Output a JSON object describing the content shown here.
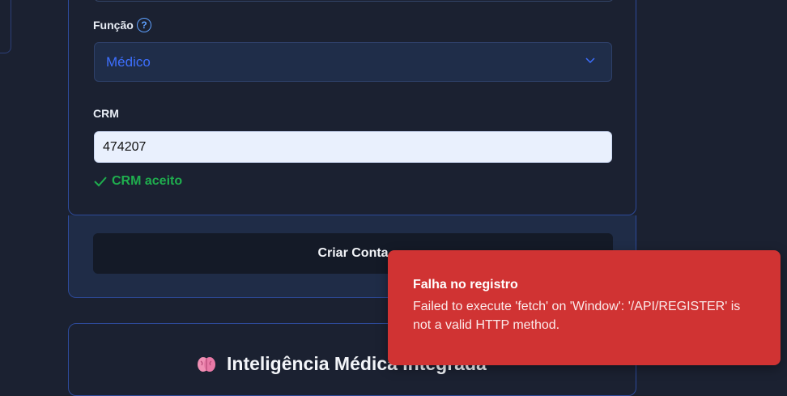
{
  "form": {
    "role_label": "Função",
    "role_value": "Médico",
    "crm_label": "CRM",
    "crm_value": "474207",
    "crm_status": "CRM aceito",
    "submit_label": "Criar Conta"
  },
  "feature": {
    "title": "Inteligência Médica Integrada",
    "icon": "brain-icon"
  },
  "toast": {
    "title": "Falha no registro",
    "message": "Failed to execute 'fetch' on 'Window': '/API/REGISTER' is not a valid HTTP method."
  },
  "colors": {
    "background": "#1b2131",
    "border_accent": "#2d4a9a",
    "select_text": "#3d6fff",
    "success": "#1fae4e",
    "toast_bg": "#d03333"
  }
}
